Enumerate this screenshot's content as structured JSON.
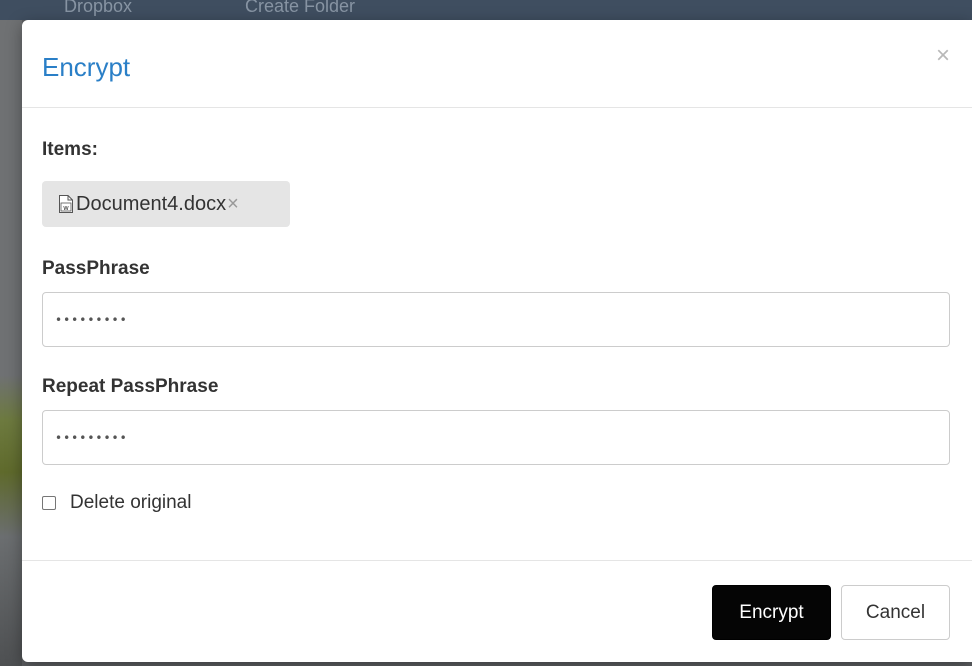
{
  "background": {
    "breadcrumb": [
      "Dropbox",
      "Create Folder"
    ]
  },
  "dialog": {
    "title": "Encrypt",
    "close_label": "×",
    "items_label": "Items:",
    "items": [
      {
        "name": "Document4.docx",
        "icon": "word-document-icon",
        "remove_label": "×"
      }
    ],
    "passphrase_label": "PassPhrase",
    "passphrase_value": "•••••••••",
    "repeat_passphrase_label": "Repeat PassPhrase",
    "repeat_passphrase_value": "•••••••••",
    "delete_original_label": "Delete original",
    "delete_original_checked": false,
    "primary_button": "Encrypt",
    "cancel_button": "Cancel"
  },
  "colors": {
    "title": "#2a7fc7",
    "primary_button_bg": "#050505",
    "chip_bg": "#e5e5e5"
  }
}
